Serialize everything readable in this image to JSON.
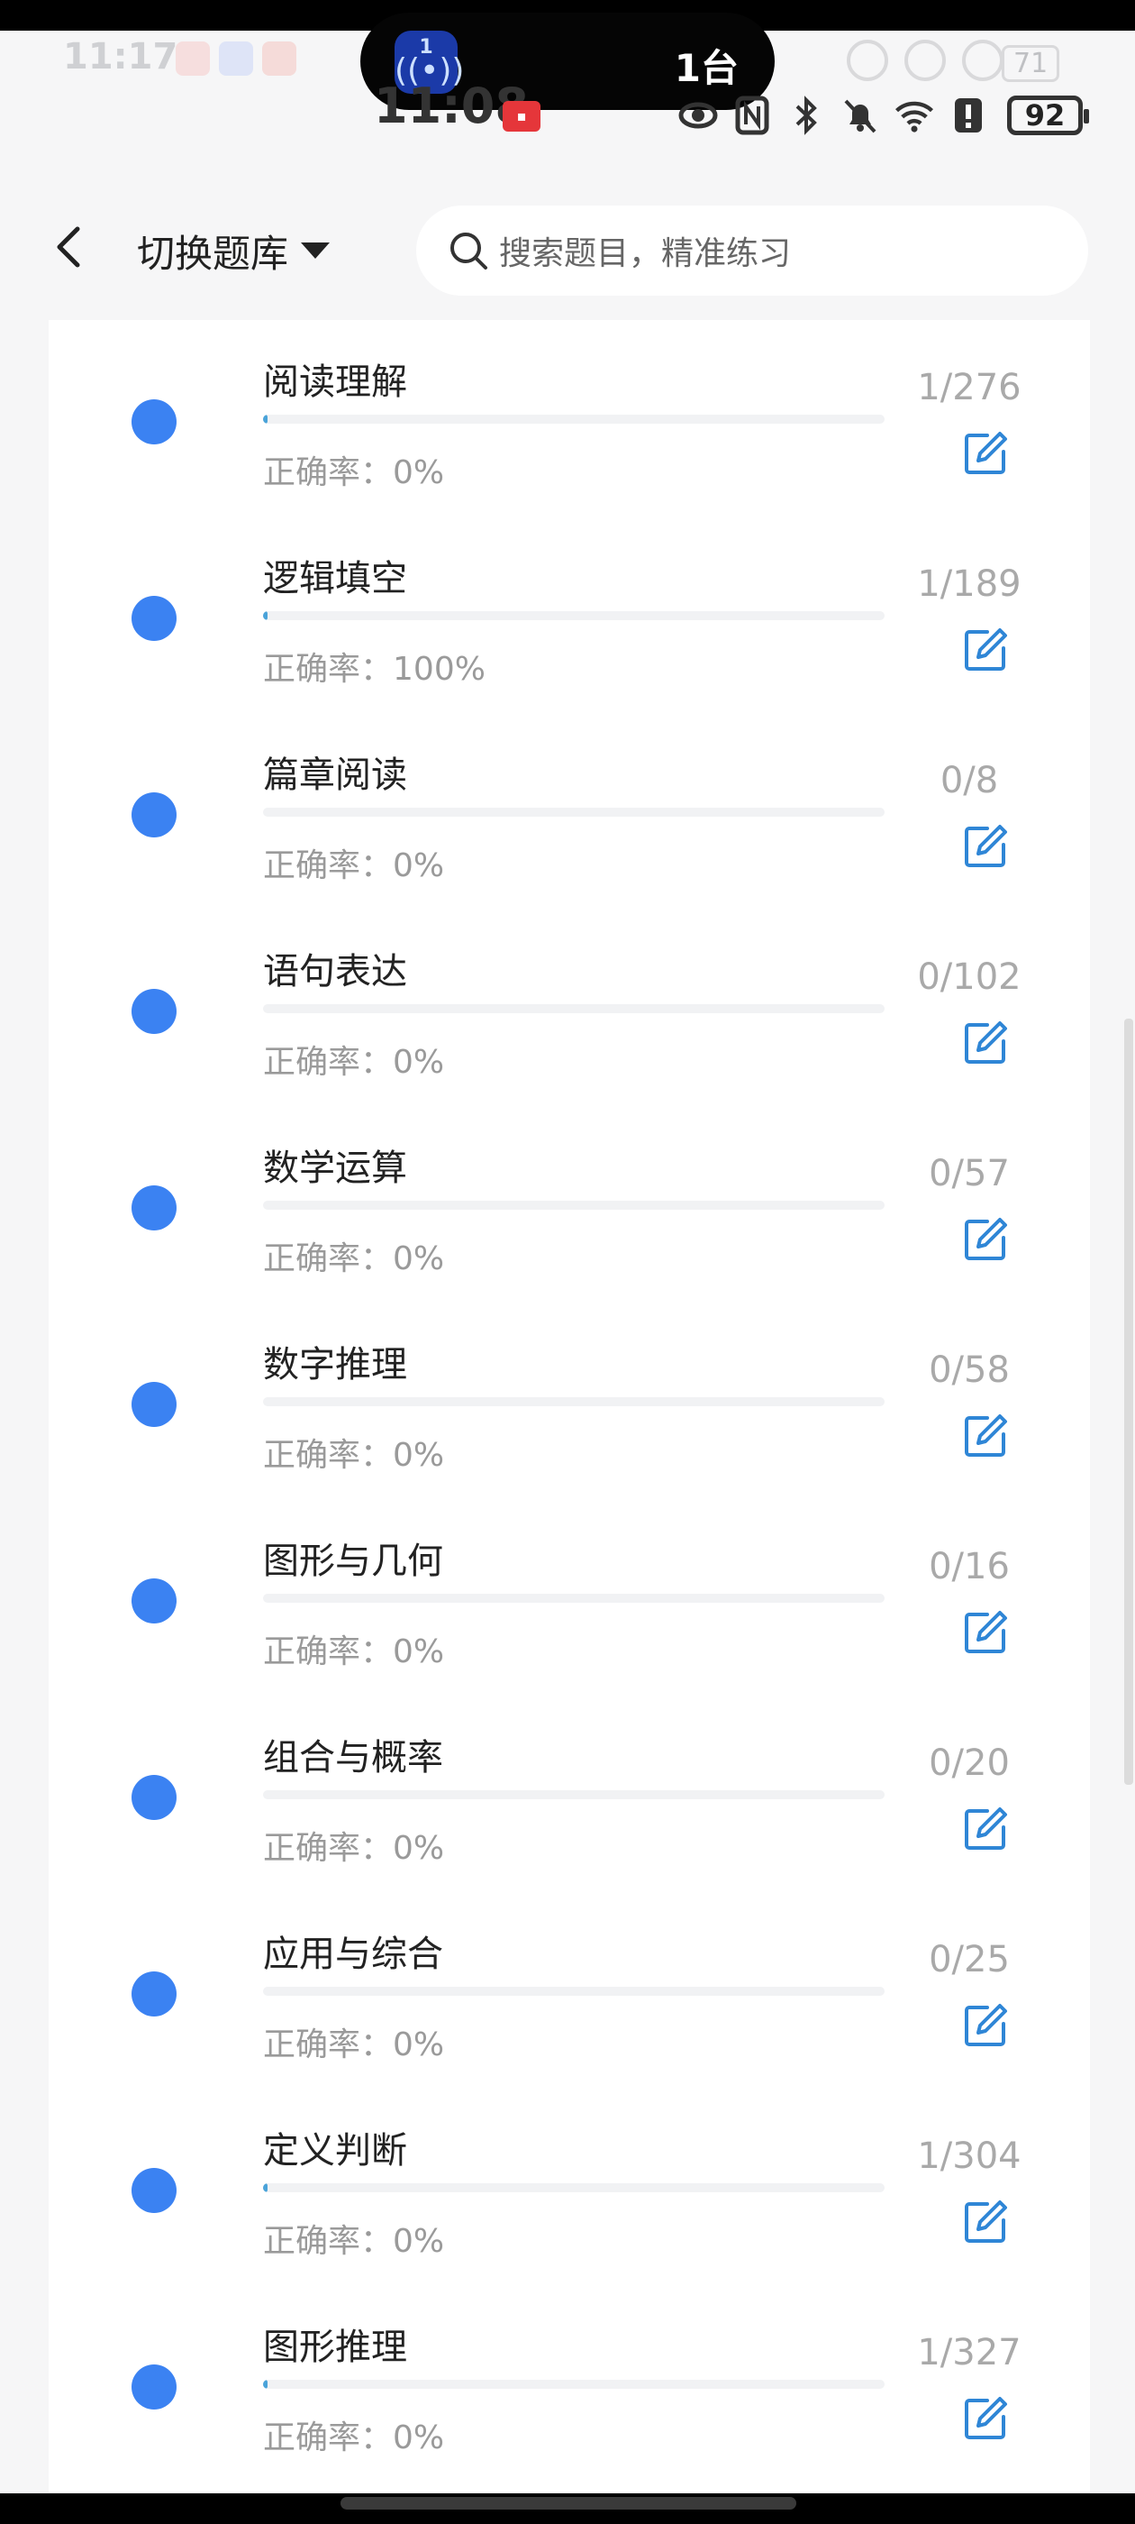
{
  "status": {
    "time": "11:08",
    "battery": "92",
    "ghost_time": "11:17",
    "ghost_battery": "71",
    "island_number": "1",
    "island_text": "1台"
  },
  "header": {
    "switch_label": "切换题库",
    "search_placeholder": "搜索题目，精准练习"
  },
  "accuracy_label": "正确率：",
  "items": [
    {
      "name": "阅读理解",
      "accuracy": "0%",
      "count": "1/276",
      "progress": 0.0036
    },
    {
      "name": "逻辑填空",
      "accuracy": "100%",
      "count": "1/189",
      "progress": 0.0053
    },
    {
      "name": "篇章阅读",
      "accuracy": "0%",
      "count": "0/8",
      "progress": 0
    },
    {
      "name": "语句表达",
      "accuracy": "0%",
      "count": "0/102",
      "progress": 0
    },
    {
      "name": "数学运算",
      "accuracy": "0%",
      "count": "0/57",
      "progress": 0
    },
    {
      "name": "数字推理",
      "accuracy": "0%",
      "count": "0/58",
      "progress": 0
    },
    {
      "name": "图形与几何",
      "accuracy": "0%",
      "count": "0/16",
      "progress": 0
    },
    {
      "name": "组合与概率",
      "accuracy": "0%",
      "count": "0/20",
      "progress": 0
    },
    {
      "name": "应用与综合",
      "accuracy": "0%",
      "count": "0/25",
      "progress": 0
    },
    {
      "name": "定义判断",
      "accuracy": "0%",
      "count": "1/304",
      "progress": 0.0033
    },
    {
      "name": "图形推理",
      "accuracy": "0%",
      "count": "1/327",
      "progress": 0.0031
    }
  ],
  "colors": {
    "accent": "#3b82f2",
    "progress_fill": "#4aa3d9",
    "edit_icon": "#2f86d6"
  }
}
